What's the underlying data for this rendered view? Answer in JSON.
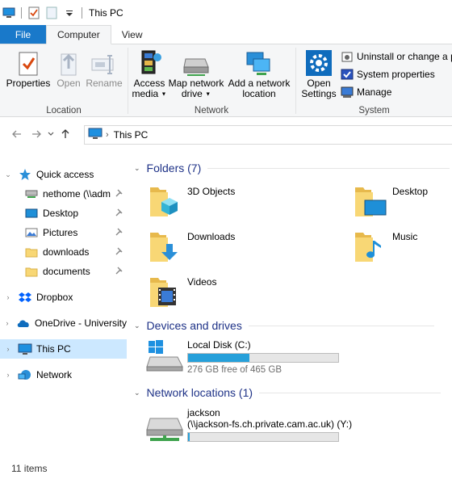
{
  "window": {
    "title": "This PC"
  },
  "ribbon": {
    "tabs": {
      "file": "File",
      "computer": "Computer",
      "view": "View"
    },
    "location_group": {
      "label": "Location",
      "properties": "Properties",
      "open": "Open",
      "rename": "Rename"
    },
    "network_group": {
      "label": "Network",
      "access_media_1": "Access",
      "access_media_2": "media",
      "map_drive_1": "Map network",
      "map_drive_2": "drive",
      "add_location_1": "Add a network",
      "add_location_2": "location"
    },
    "system_group": {
      "label": "System",
      "open_settings_1": "Open",
      "open_settings_2": "Settings",
      "uninstall": "Uninstall or change a p",
      "system_properties": "System properties",
      "manage": "Manage"
    }
  },
  "address": {
    "path": "This PC"
  },
  "nav": {
    "quick_access": "Quick access",
    "nethome": "nethome (\\\\adm",
    "desktop": "Desktop",
    "pictures": "Pictures",
    "downloads": "downloads",
    "documents": "documents",
    "dropbox": "Dropbox",
    "onedrive": "OneDrive - University",
    "this_pc": "This PC",
    "network": "Network"
  },
  "content": {
    "folders_header": "Folders (7)",
    "folders": {
      "objects3d": "3D Objects",
      "desktop": "Desktop",
      "downloads": "Downloads",
      "music": "Music",
      "videos": "Videos"
    },
    "devices_header": "Devices and drives",
    "local_disk": {
      "name": "Local Disk (C:)",
      "free": "276 GB free of 465 GB",
      "used_fraction": 0.41
    },
    "network_header": "Network locations (1)",
    "network_drive": {
      "name_line1": "jackson",
      "name_line2": "(\\\\jackson-fs.ch.private.cam.ac.uk) (Y:)",
      "used_fraction": 0.01
    }
  },
  "status": {
    "items": "11 items"
  },
  "colors": {
    "accent": "#1979ca",
    "header_text": "#1e3287",
    "selection": "#cce8ff",
    "progress": "#26a0da",
    "folder": "#f8d775"
  }
}
